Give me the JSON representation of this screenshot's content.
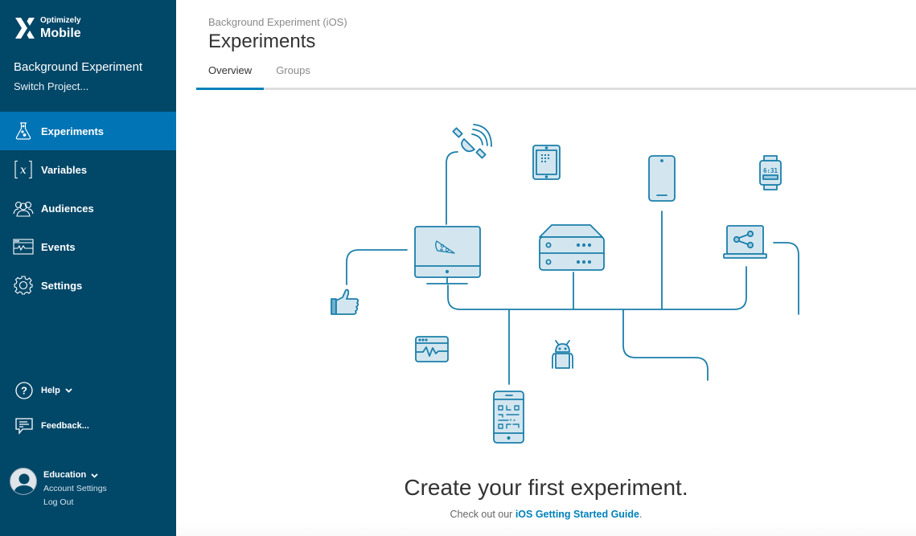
{
  "app": {
    "brand_small": "Optimizely",
    "brand_big": "Mobile"
  },
  "sidebar": {
    "project_name": "Background Experiment",
    "switch_project": "Switch Project...",
    "items": [
      {
        "label": "Experiments",
        "icon": "flask-icon",
        "active": true
      },
      {
        "label": "Variables",
        "icon": "variable-x-icon",
        "active": false
      },
      {
        "label": "Audiences",
        "icon": "people-icon",
        "active": false
      },
      {
        "label": "Events",
        "icon": "pulse-window-icon",
        "active": false
      },
      {
        "label": "Settings",
        "icon": "gear-icon",
        "active": false
      }
    ],
    "help_label": "Help",
    "feedback_label": "Feedback...",
    "account": {
      "name": "Education",
      "settings_link": "Account Settings",
      "logout_link": "Log Out"
    }
  },
  "header": {
    "breadcrumb": "Background Experiment (iOS)",
    "title": "Experiments",
    "tabs": [
      {
        "label": "Overview",
        "active": true
      },
      {
        "label": "Groups",
        "active": false
      }
    ]
  },
  "empty_state": {
    "title": "Create your first experiment.",
    "subtitle_prefix": "Check out our ",
    "guide_link": "iOS Getting Started Guide",
    "subtitle_suffix": "."
  },
  "illustration": {
    "watch_time": "6:31"
  },
  "colors": {
    "sidebar_bg": "#014768",
    "sidebar_active": "#0074b4",
    "accent": "#0081ba",
    "illustration_stroke": "#1b7fab",
    "illustration_fill": "#d3e6ef"
  }
}
